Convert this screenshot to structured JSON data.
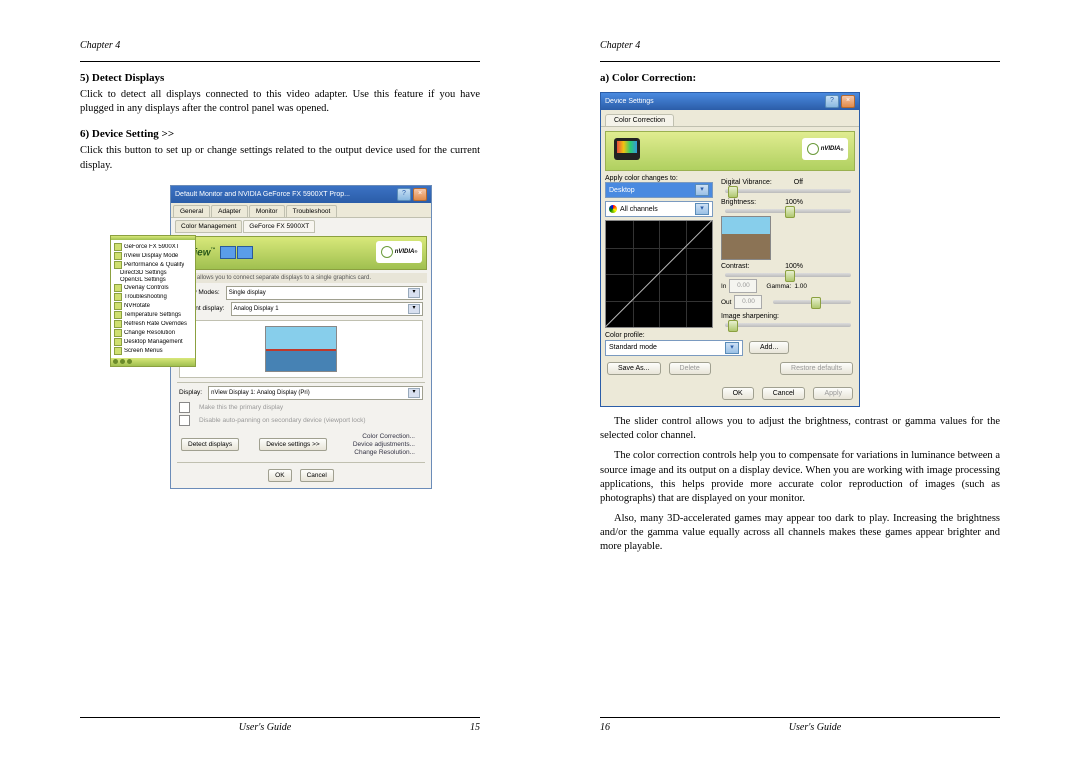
{
  "chapterLabel": "Chapter  4",
  "leftPage": {
    "sec5": {
      "title": "5)  Detect Displays",
      "text": "Click to detect all displays connected to this video adapter. Use this feature if you have plugged in any displays after the control panel was opened."
    },
    "sec6": {
      "title": "6)  Device Setting >>",
      "text": "Click this button to set up or change settings related to the output device used for the current display."
    },
    "dialog": {
      "title": "Default Monitor and NVIDIA GeForce FX 5900XT Prop...",
      "tabs": {
        "general": "General",
        "adapter": "Adapter",
        "monitor": "Monitor",
        "troubleshoot": "Troubleshoot",
        "colormgmt": "Color Management",
        "gf": "GeForce FX 5900XT"
      },
      "nviewLogo": "nView",
      "nvidiaLabel": "nVIDIA",
      "bannerSub": "nView allows you to connect separate displays to a single graphics card.",
      "modeLabel": "nView Modes:",
      "modeValue": "Single display",
      "currDisplayLabel": "Current display:",
      "currDisplayValue": "Analog Display 1",
      "displayLabel": "Display:",
      "displayValue": "nView Display 1: Analog Display (Pri)",
      "chk1": "Make this the primary display",
      "chk2": "Disable auto-panning on secondary device (viewport lock)",
      "detectBtn": "Detect displays",
      "devSettingsBtn": "Device settings >>",
      "links": {
        "cc": "Color Correction...",
        "da": "Device adjustments...",
        "cr": "Change Resolution..."
      },
      "ok": "OK",
      "cancel": "Cancel"
    },
    "sidebar": {
      "items": [
        "GeForce FX 5900XT",
        "nView Display Mode",
        "Performance & Quality",
        "Direct3D Settings",
        "OpenGL Settings",
        "Overlay Controls",
        "Troubleshooting",
        "NVRotate",
        "Temperature Settings",
        "Refresh Rate Overrides",
        "Change Resolution",
        "Desktop Management",
        "Screen Menus"
      ]
    },
    "footer": {
      "label": "User's Guide",
      "num": "15"
    }
  },
  "rightPage": {
    "secA": {
      "title": "a)  Color Correction:"
    },
    "dialog": {
      "title": "Device Settings",
      "tab": "Color Correction",
      "nvidiaLabel": "nVIDIA",
      "applyTo": "Apply color changes to:",
      "applyToVal": "Desktop",
      "channels": "All channels",
      "digitalVibrance": "Digital Vibrance:",
      "dvVal": "Off",
      "brightness": "Brightness:",
      "brightVal": "100%",
      "contrast": "Contrast:",
      "contrastVal": "100%",
      "gamma": "Gamma:",
      "gammaVal": "1.00",
      "inLabel": "In",
      "outLabel": "Out",
      "ioVal": "0.00",
      "sharpen": "Image sharpening:",
      "colorProfile": "Color profile:",
      "profileVal": "Standard mode",
      "addBtn": "Add...",
      "saveAs": "Save As...",
      "delete": "Delete",
      "restore": "Restore defaults",
      "ok": "OK",
      "cancel": "Cancel",
      "apply": "Apply"
    },
    "para1": "The slider control allows you to adjust the brightness, contrast or gamma values for the selected color channel.",
    "para2": "The color correction controls help you to compensate for variations in luminance between a source image and its output on a display device. When you are working with image processing applications, this helps provide more accurate color reproduction of images (such as photographs) that are displayed on your monitor.",
    "para3": "Also, many 3D-accelerated games may appear too dark to play. Increasing the brightness and/or the gamma value equally across all channels makes these games appear brighter and more playable.",
    "footer": {
      "label": "User's Guide",
      "num": "16"
    }
  }
}
